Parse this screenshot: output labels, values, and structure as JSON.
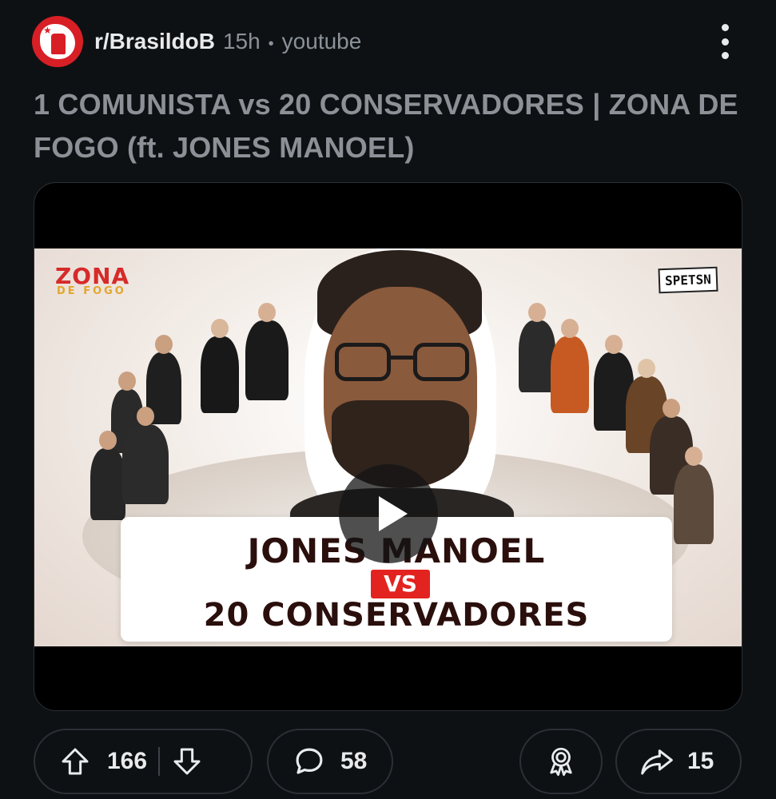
{
  "post": {
    "subreddit": "r/BrasildoB",
    "time": "15h",
    "separator": "•",
    "source": "youtube",
    "title": "1 COMUNISTA vs 20 CONSERVADORES | ZONA DE FOGO (ft. JONES MANOEL)"
  },
  "thumbnail": {
    "logo_main": "ZONA",
    "logo_sub": "DE FOGO",
    "brand_right": "SPETSN",
    "caption_line1": "JONES MANOEL",
    "caption_vs": "VS",
    "caption_line3": "20 CONSERVADORES"
  },
  "actions": {
    "upvotes": "166",
    "comments": "58",
    "shares": "15"
  },
  "icons": {
    "avatar": "subreddit-avatar-icon",
    "menu": "more-options-icon",
    "play": "play-icon",
    "upvote": "upvote-arrow-icon",
    "downvote": "downvote-arrow-icon",
    "comment": "comment-bubble-icon",
    "award": "award-icon",
    "share": "share-arrow-icon"
  },
  "colors": {
    "background": "#0e1113",
    "avatar_red": "#d81f26",
    "title_gray": "#8b9196",
    "vs_red": "#e3231f"
  }
}
